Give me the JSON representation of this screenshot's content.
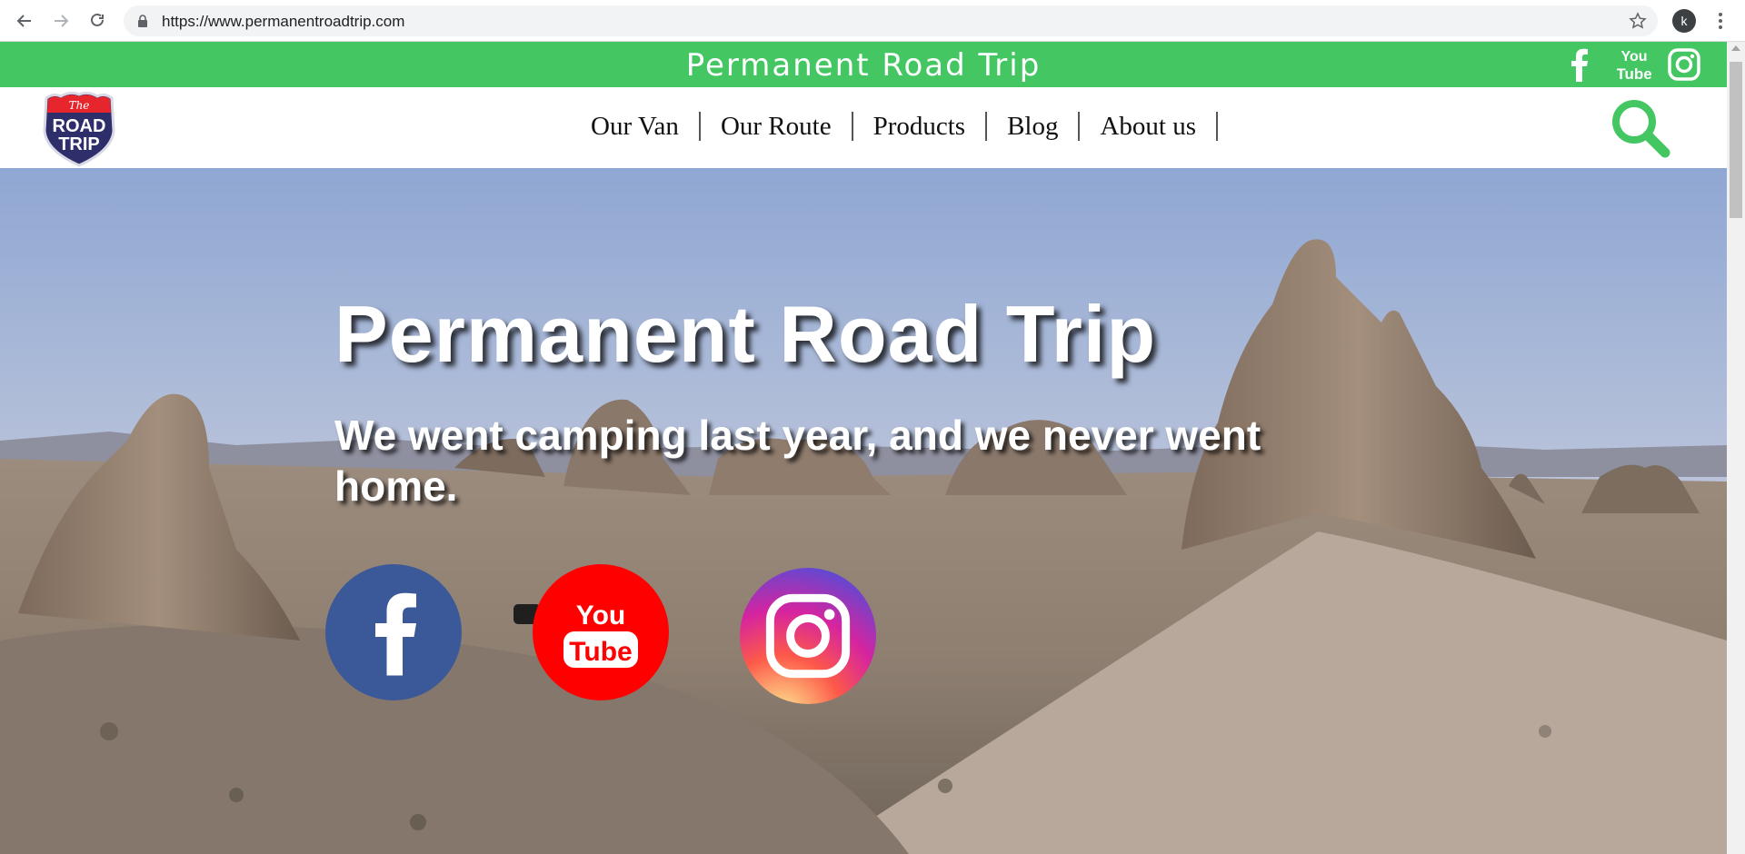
{
  "browser": {
    "url": "https://www.permanentroadtrip.com",
    "profile_initial": "k"
  },
  "topbar": {
    "title": "Permanent Road Trip",
    "color": "#44c662",
    "social_icons": [
      "facebook-icon",
      "youtube-icon",
      "instagram-icon"
    ]
  },
  "header": {
    "logo": {
      "top_text": "The",
      "line1": "ROAD",
      "line2": "TRIP"
    },
    "nav": [
      {
        "label": "Our Van"
      },
      {
        "label": "Our Route"
      },
      {
        "label": "Products"
      },
      {
        "label": "Blog"
      },
      {
        "label": "About us"
      }
    ],
    "search_icon_color": "#44c662"
  },
  "hero": {
    "title": "Permanent Road Trip",
    "tagline": "We went camping last year, and we never went home.",
    "social": [
      {
        "name": "facebook",
        "color": "#3b5998"
      },
      {
        "name": "youtube",
        "color": "#ff0000",
        "text_top": "You",
        "text_bottom": "Tube"
      },
      {
        "name": "instagram",
        "color": "#c13584"
      }
    ]
  }
}
